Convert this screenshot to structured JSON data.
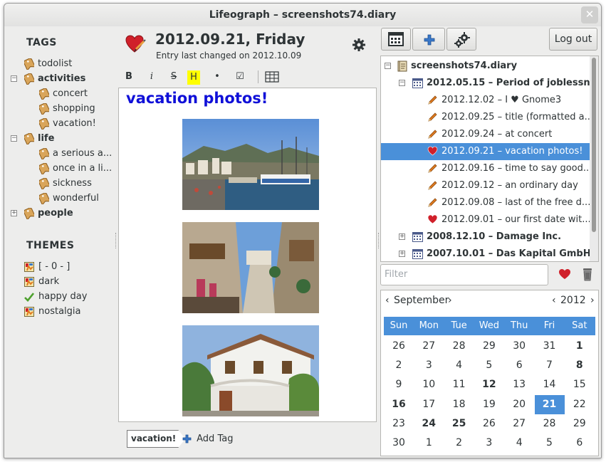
{
  "window": {
    "title": "Lifeograph – screenshots74.diary"
  },
  "tags": {
    "heading": "TAGS",
    "items": [
      {
        "label": "todolist",
        "level": 0,
        "bold": false,
        "expander": ""
      },
      {
        "label": "activities",
        "level": 0,
        "bold": true,
        "expander": "−"
      },
      {
        "label": "concert",
        "level": 1,
        "bold": false,
        "expander": ""
      },
      {
        "label": "shopping",
        "level": 1,
        "bold": false,
        "expander": ""
      },
      {
        "label": "vacation!",
        "level": 1,
        "bold": false,
        "expander": ""
      },
      {
        "label": "life",
        "level": 0,
        "bold": true,
        "expander": "−"
      },
      {
        "label": "a serious a...",
        "level": 1,
        "bold": false,
        "expander": ""
      },
      {
        "label": "once in a li...",
        "level": 1,
        "bold": false,
        "expander": ""
      },
      {
        "label": "sickness",
        "level": 1,
        "bold": false,
        "expander": ""
      },
      {
        "label": "wonderful",
        "level": 1,
        "bold": false,
        "expander": ""
      },
      {
        "label": "people",
        "level": 0,
        "bold": true,
        "expander": "+"
      }
    ]
  },
  "themes": {
    "heading": "THEMES",
    "items": [
      {
        "label": "[ - 0 - ]",
        "icon": "theme-icon",
        "active": false
      },
      {
        "label": "dark",
        "icon": "theme-icon",
        "active": false
      },
      {
        "label": "happy day",
        "icon": "check-icon",
        "active": true
      },
      {
        "label": "nostalgia",
        "icon": "theme-icon",
        "active": false
      }
    ]
  },
  "entry": {
    "date_title": "2012.09.21, Friday",
    "last_changed": "Entry last changed on 2012.10.09",
    "title": "vacation photos!"
  },
  "format_toolbar": {
    "bold": "B",
    "italic": "i",
    "strikethrough": "S",
    "highlight": "H",
    "bullet": "•",
    "checkbox": "☑"
  },
  "entry_tags": {
    "chip": "vacation!",
    "add_tag": "Add Tag"
  },
  "toolbar": {
    "logout": "Log out"
  },
  "diary_tree": {
    "rows": [
      {
        "label": "screenshots74.diary",
        "level": 0,
        "icon": "diary-icon",
        "bold": true,
        "expander": "−",
        "selected": false
      },
      {
        "label": "2012.05.15 –  Period of joblessn...",
        "level": 1,
        "icon": "calendar-icon",
        "bold": true,
        "expander": "−",
        "selected": false
      },
      {
        "label": "2012.12.02 –  I ♥ Gnome3",
        "level": 2,
        "icon": "pencil-icon",
        "bold": false,
        "expander": "",
        "selected": false
      },
      {
        "label": "2012.09.25 –  title (formatted a...",
        "level": 2,
        "icon": "pencil-icon",
        "bold": false,
        "expander": "",
        "selected": false
      },
      {
        "label": "2012.09.24 –  at concert",
        "level": 2,
        "icon": "pencil-icon",
        "bold": false,
        "expander": "",
        "selected": false
      },
      {
        "label": "2012.09.21 –  vacation photos!",
        "level": 2,
        "icon": "heart-icon",
        "bold": false,
        "expander": "",
        "selected": true
      },
      {
        "label": "2012.09.16 –  time to say good...",
        "level": 2,
        "icon": "pencil-icon",
        "bold": false,
        "expander": "",
        "selected": false
      },
      {
        "label": "2012.09.12 –  an ordinary day",
        "level": 2,
        "icon": "pencil-icon",
        "bold": false,
        "expander": "",
        "selected": false
      },
      {
        "label": "2012.09.08 –  last of the free d...",
        "level": 2,
        "icon": "pencil-icon",
        "bold": false,
        "expander": "",
        "selected": false
      },
      {
        "label": "2012.09.01 –  our first date wit...",
        "level": 2,
        "icon": "heart-icon",
        "bold": false,
        "expander": "",
        "selected": false
      },
      {
        "label": "2008.12.10 –  Damage Inc.",
        "level": 1,
        "icon": "calendar-icon",
        "bold": true,
        "expander": "+",
        "selected": false
      },
      {
        "label": "2007.10.01 –  Das Kapital GmbH",
        "level": 1,
        "icon": "calendar-icon",
        "bold": true,
        "expander": "+",
        "selected": false
      }
    ]
  },
  "filter": {
    "placeholder": "Filter"
  },
  "calendar": {
    "month": "September",
    "year": "2012",
    "weekdays": [
      "Sun",
      "Mon",
      "Tue",
      "Wed",
      "Thu",
      "Fri",
      "Sat"
    ],
    "weeks": [
      [
        "26",
        "27",
        "28",
        "29",
        "30",
        "31",
        "1"
      ],
      [
        "2",
        "3",
        "4",
        "5",
        "6",
        "7",
        "8"
      ],
      [
        "9",
        "10",
        "11",
        "12",
        "13",
        "14",
        "15"
      ],
      [
        "16",
        "17",
        "18",
        "19",
        "20",
        "21",
        "22"
      ],
      [
        "23",
        "24",
        "25",
        "26",
        "27",
        "28",
        "29"
      ],
      [
        "30",
        "1",
        "2",
        "3",
        "4",
        "5",
        "6"
      ]
    ],
    "bold_days": [
      "1",
      "8",
      "12",
      "16",
      "24",
      "25"
    ],
    "selected_day": "21"
  },
  "colors": {
    "accent": "#4a90d9",
    "title_blue": "#1010d8",
    "heart_red": "#d0202a",
    "pencil_orange": "#e07a1f",
    "highlight_yellow": "#ffff00"
  }
}
